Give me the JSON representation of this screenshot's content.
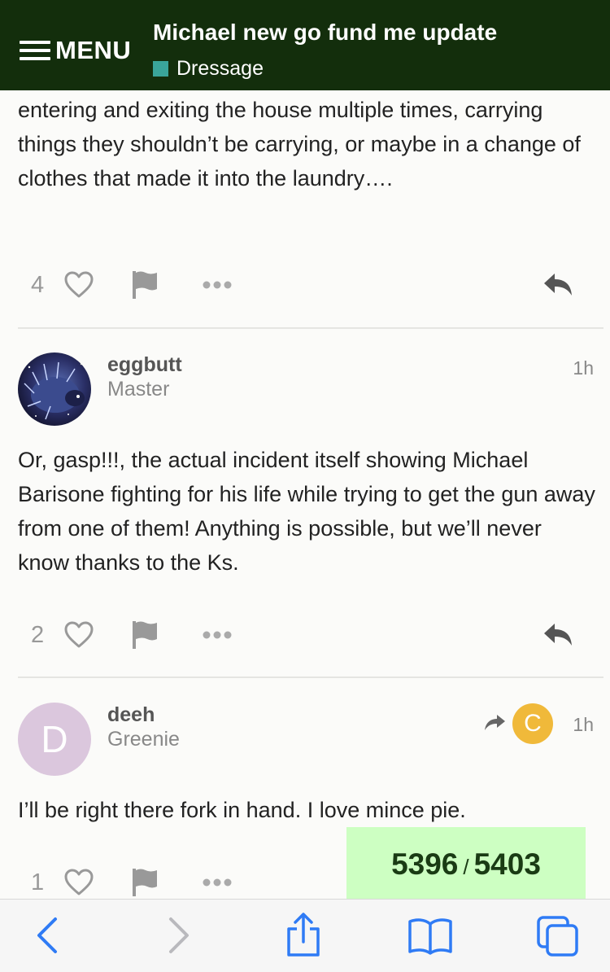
{
  "header": {
    "menu_label": "MENU",
    "topic_title": "Michael new go fund me update",
    "category": "Dressage",
    "category_color": "#3aa59a"
  },
  "posts": [
    {
      "text": "entering and exiting the house multiple times, carrying things they shouldn’t be carrying, or maybe in a change of clothes that made it into the laundry….",
      "likes": "4"
    },
    {
      "username": "eggbutt",
      "user_title": "Master",
      "time": "1h",
      "text": "Or, gasp!!!, the actual incident itself showing Michael Barisone fighting for his life while trying to get the gun away from one of them! Anything is possible, but we’ll never know thanks to the Ks.",
      "likes": "2"
    },
    {
      "username": "deeh",
      "user_title": "Greenie",
      "avatar_letter": "D",
      "reply_to_letter": "C",
      "time": "1h",
      "text": "I’ll be right there fork in hand. I love mince pie.",
      "likes": "1"
    }
  ],
  "progress": {
    "current": "5396",
    "separator": "/",
    "total": "5403"
  },
  "toolbar": {
    "icons": [
      "back-icon",
      "forward-icon",
      "share-icon",
      "bookmarks-icon",
      "tabs-icon"
    ]
  },
  "colors": {
    "header_bg": "#132e0c",
    "progress_bg": "#cdffc2",
    "safari_blue": "#2f7bf5"
  }
}
